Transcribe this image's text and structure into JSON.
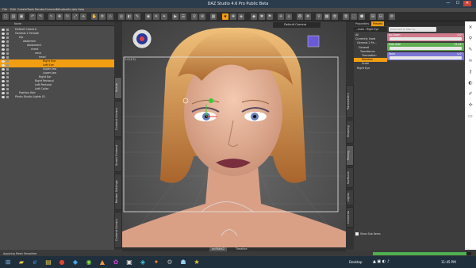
{
  "window": {
    "title": "DAZ Studio 4.6 Pro Public Beta",
    "minimize": "—",
    "maximize": "☐",
    "close": "✕"
  },
  "menu": [
    "File",
    "Edit",
    "Create",
    "Tools",
    "Render",
    "Connect",
    "Window",
    "Scripts",
    "Help"
  ],
  "scene": {
    "header": "Node",
    "items": [
      {
        "label": "Default Camera",
        "indent": 1,
        "selected": false
      },
      {
        "label": "Genesis 2 Female",
        "indent": 1,
        "selected": false
      },
      {
        "label": "hip",
        "indent": 2,
        "selected": false
      },
      {
        "label": "abdomen",
        "indent": 3,
        "selected": false
      },
      {
        "label": "Abdomen2",
        "indent": 4,
        "selected": false
      },
      {
        "label": "chest",
        "indent": 5,
        "selected": false
      },
      {
        "label": "neck",
        "indent": 6,
        "selected": false
      },
      {
        "label": "head",
        "indent": 7,
        "selected": false
      },
      {
        "label": "Right Eye",
        "indent": 8,
        "selected": true
      },
      {
        "label": "Left Eye",
        "indent": 8,
        "selected": true
      },
      {
        "label": "Upper Jaw",
        "indent": 8,
        "selected": false
      },
      {
        "label": "Lower Jaw",
        "indent": 8,
        "selected": false
      },
      {
        "label": "Right Ear",
        "indent": 7,
        "selected": false
      },
      {
        "label": "Right Pectoral",
        "indent": 6,
        "selected": false
      },
      {
        "label": "Left Pectoral",
        "indent": 6,
        "selected": false
      },
      {
        "label": "Left Collar",
        "indent": 6,
        "selected": false
      },
      {
        "label": "Fashion Hair",
        "indent": 2,
        "selected": false
      },
      {
        "label": "Photo Studio Lights 01",
        "indent": 1,
        "selected": false
      }
    ]
  },
  "left_tabs": [
    "Scene",
    "Content Library",
    "Smart Content",
    "Render Settings",
    "Content Library"
  ],
  "viewport": {
    "camera": "Default Camera",
    "frame_label": "1:4  (4:3)"
  },
  "right_tabs": [
    "Parameters",
    "Shaping",
    "Posing",
    "Surfaces",
    "Lights",
    "Cameras"
  ],
  "params": {
    "tabs": [
      "Properties",
      "Presets"
    ],
    "node_select": "...male : Right Eye",
    "search_placeholder": "Enter text to filter by",
    "groups": [
      "All",
      "Currently Used",
      "Genesis 2 Fe...",
      "General",
      "Transforms",
      "Translation",
      "Rotation",
      "Scale",
      "Right Eye"
    ],
    "sliders": [
      {
        "name": "Up-Down",
        "value": "0.0°",
        "color": "#d07a8c"
      },
      {
        "name": "Side-Side",
        "value": "34.44°",
        "color": "#5fae53"
      },
      {
        "name": "Twist",
        "value": "0.0°",
        "color": "#7a78d4"
      }
    ],
    "footer": "Show Sub Items"
  },
  "bottom_tabs": [
    "aniMate2",
    "Timeline"
  ],
  "status": {
    "text": "Applying Mesh Smoother",
    "progress_label": "",
    "progress": 0.95
  },
  "taskbar": {
    "desktop": "Desktop",
    "time": "11:45 PM"
  },
  "colors": {
    "accent": "#f29e12",
    "titlebar": "#2b3c4c",
    "taskbar": "#1f2f3c"
  }
}
